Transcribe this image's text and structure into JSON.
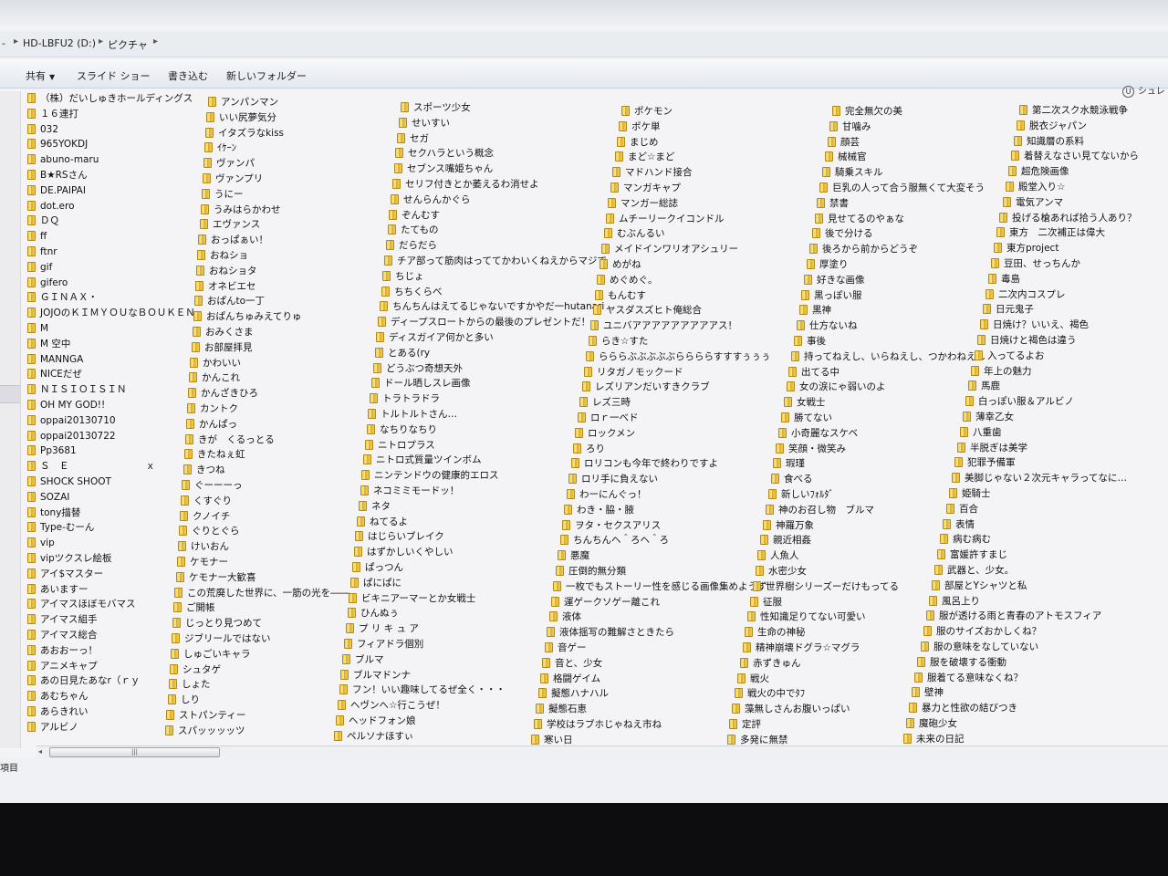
{
  "address": {
    "prefix": "-",
    "drive": "HD-LBFU2 (D:)",
    "folder": "ピクチャ"
  },
  "toolbar": {
    "share": "共有",
    "slideshow": "スライド ショー",
    "burn": "書き込む",
    "new_folder": "新しいフォルダー",
    "right_label": "シュレ"
  },
  "status": {
    "text": "項目"
  },
  "scroll": {
    "thumb_grip": "|||"
  },
  "columns": [
    [
      "（株）だいしゅきホールディングス",
      "１６連打",
      "032",
      "965YOKDJ",
      "abuno-maru",
      "B★RSさん",
      "DE.PAIPAI",
      "dot.ero",
      "ＤＱ",
      "ff",
      "ftnr",
      "gif",
      "gifero",
      "ＧＩＮＡＸ・",
      "JOJOのＫＩＭＹＯＵなＢＯＵＫＥＮ",
      "M",
      "M 空中",
      "MANNGA",
      "NICEだぜ",
      "ＮＩＳＩＯＩＳＩＮ",
      "OH MY GOD!!",
      "oppai20130710",
      "oppai20130722",
      "Pp3681",
      "Ｓ　Ｅ　　　　　　　　ｘ",
      "SHOCK SHOOT",
      "SOZAI",
      "tony描替",
      "Type-むーん",
      "vip",
      "vipツクスレ絵板",
      "アイ$マスター",
      "あいますー",
      "アイマスほぼモバマス",
      "アイマス組手",
      "アイマス総合",
      "あおおーっ！",
      "アニメキャプ",
      "あの日見たあなr（ｒｙ",
      "あむちゃん",
      "あらきれい",
      "アルビノ"
    ],
    [
      "アンパンマン",
      "いい尻夢気分",
      "イタズラなkiss",
      "ｲｹｰﾝ",
      "ヴァンパ",
      "ヴァンプリ",
      "うにー",
      "うみはらかわせ",
      "エヴァンス",
      "おっぱぁい！",
      "おねショ",
      "おねショタ",
      "オネビエセ",
      "おぱんto一丁",
      "おぱんちゅみえてりゅ",
      "おみくさま",
      "お部屋拝見",
      "かわいい",
      "かんこれ",
      "かんざきひろ",
      "カントク",
      "かんぱっ",
      "きが　くるっとる",
      "きたねぇ虹",
      "きつね",
      "ぐーーーっ",
      "くすぐり",
      "クノイチ",
      "ぐりとぐら",
      "けいおん",
      "ケモナー",
      "ケモナー大歓喜",
      "この荒廃した世界に、一筋の光を――",
      "ご開帳",
      "じっとり見つめて",
      "ジブリールではない",
      "しゅごいキャラ",
      "シュタゲ",
      "しょた",
      "しり",
      "ストパンティー",
      "スパッッッッツ"
    ],
    [
      "スポーツ少女",
      "せいすい",
      "セガ",
      "セクハラという概念",
      "セブンス嘴姫ちゃん",
      "セリフ付きとか萎えるわ消せよ",
      "せんらんかぐら",
      "ぞんむす",
      "たてもの",
      "だらだら",
      "チア部って筋肉はっててかわいくねえからマジで",
      "ちじょ",
      "ちちくらべ",
      "ちんちんはえてるじゃないですかやだ一hutanari",
      "ディープスロートからの最後のプレゼントだ！",
      "ディスガイア何かと多い",
      "とある(ry",
      "どうぶつ奇想天外",
      "ドール晒しスレ画像",
      "トラトラドラ",
      "トルトルトさん…",
      "なちりなちり",
      "ニトロプラス",
      "ニトロ式質量ツインボム",
      "ニンテンドウの健康的エロス",
      "ネコミミモードッ！",
      "ネタ",
      "ねてるよ",
      "はじらいブレイク",
      "はずかしいくやしい",
      "ぱっつん",
      "ぱにぱに",
      "ビキニアーマーとか女戦士",
      "ひんぬぅ",
      "プ リ キ ュ ア",
      "フィアドラ個別",
      "ブルマ",
      "ブルマドンナ",
      "フン！いい趣味してるぜ全く・・・",
      "ヘヴンへ☆行こうぜ！",
      "ヘッドフォン娘",
      "ペルソナほすぃ"
    ],
    [
      "ポケモン",
      "ポケ単",
      "まじめ",
      "まど☆まど",
      "マドハンド接合",
      "マンガキャプ",
      "マンガー総誌",
      "ムチーリークイコンドル",
      "むぶんるい",
      "メイドインワリオアシュリー",
      "めがね",
      "めぐめぐ。",
      "もんむす",
      "ヤスダスズヒト俺総合",
      "ユニバアアアアアアアアアス！",
      "らき☆すた",
      "らららぶぶぶぶぶららららすすすぅぅぅ",
      "リタガノモックード",
      "レズリアンだいすきクラブ",
      "レズ三時",
      "ロｒ一べド",
      "ロックメン",
      "ろり",
      "ロリコンも今年で終わりですよ",
      "ロリ手に負えない",
      "わーにんぐっ！",
      "わき・脇・腋",
      "ヲタ・セクスアリス",
      "ちんちんヘ＾ろヘ＾ろ",
      "悪魔",
      "圧倒的無分類",
      "一枚でもストーリー性を感じる画像集めようず",
      "運ゲークソゲー離これ",
      "液体",
      "液体揺写の難解さときたら",
      "音ゲー",
      "音と、少女",
      "格闘ゲイム",
      "擬態ハナハル",
      "擬態石恵",
      "学校はラブホじゃねえ市ね",
      "寒い日"
    ],
    [
      "完全無欠の美",
      "甘噛み",
      "顔芸",
      "械械官",
      "騎乗スキル",
      "巨乳の人って合う服無くて大変そう",
      "禁書",
      "見せてるのやぁな",
      "後で分ける",
      "後ろから前からどうぞ",
      "厚塗り",
      "好きな画像",
      "黒っぽい服",
      "黒神",
      "仕方ないね",
      "事後",
      "持ってねえし、いらねえし、つかわねえし",
      "出てる中",
      "女の涙にゃ弱いのよ",
      "女戦士",
      "勝てない",
      "小奇麗なスケベ",
      "笑顔・微笑み",
      "瑕瑾",
      "食べる",
      "新しいﾌｫﾙﾀﾞ",
      "神のお召し物　ブルマ",
      "神羅万象",
      "親近相姦",
      "人魚人",
      "水密少女",
      "世界樹シリーズーだけもってる",
      "征服",
      "性知識足りてない可愛い",
      "生命の神秘",
      "精神崩壊ドグラ☆マグラ",
      "赤ずきゅん",
      "戦火",
      "戦火の中でﾀﾌ",
      "藻無しさんお腹いっぱい",
      "定評",
      "多発に無禁"
    ],
    [
      "第二次スク水競泳戦争",
      "脱衣ジャパン",
      "知識層の系料",
      "着替えなさい見てないから",
      "超危険画像",
      "殿堂入り☆",
      "電気アンマ",
      "投げる槍あれば拾う人あり？",
      "東方　二次補正は偉大",
      "東方project",
      "豆田、せっちんか",
      "毒島",
      "二次内コスプレ",
      "日元鬼子",
      "日焼け？いいえ、褐色",
      "日焼けと褐色は違う",
      "入ってるよお",
      "年上の魅力",
      "馬鹿",
      "白っぽい服＆アルビノ",
      "薄幸乙女",
      "八重歯",
      "半脱ぎは美学",
      "犯罪予備軍",
      "美脚じゃない２次元キャラってなに…",
      "姫騎士",
      "百合",
      "表情",
      "病む病む",
      "富媛許すまじ",
      "武器と、少女。",
      "部屋とYシャツと私",
      "風呂上り",
      "服が透ける雨と青春のアトモスフィア",
      "服のサイズおかしくね？",
      "服の意味をなしていない",
      "服を破壊する衝動",
      "服着てる意味なくね？",
      "壁神",
      "暴力と性欲の結びつき",
      "魔砲少女",
      "未来の日記"
    ]
  ]
}
